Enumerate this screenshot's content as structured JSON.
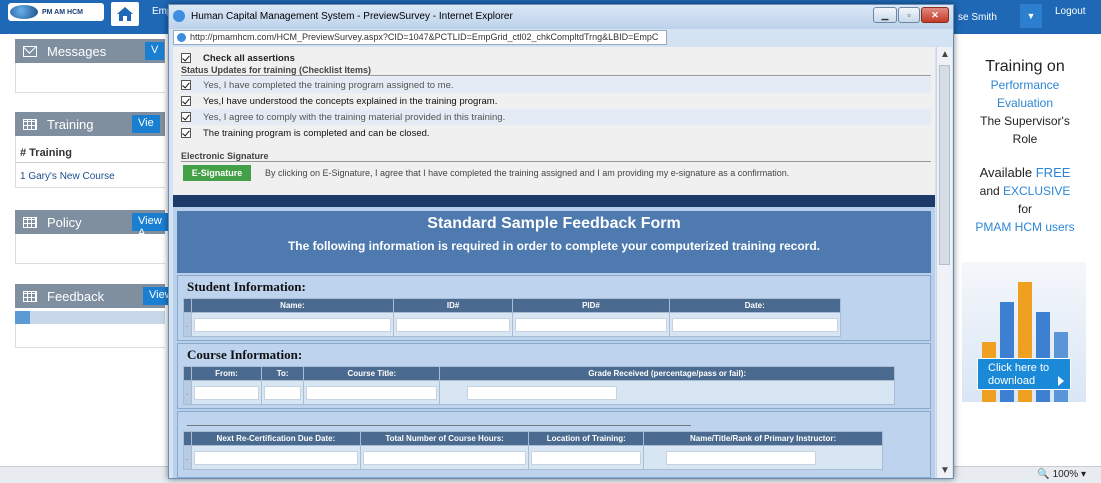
{
  "app": {
    "logo_text": "PM AM HCM",
    "nav_partial": "Emp",
    "user_partial": "se Smith",
    "logout": "Logout"
  },
  "left": {
    "messages": {
      "title": "Messages",
      "view": "V"
    },
    "training": {
      "title": "Training",
      "view": "Vie",
      "col_header": "# Training",
      "items": [
        {
          "num": "1",
          "name": "Gary's New Course"
        }
      ]
    },
    "policy": {
      "title": "Policy",
      "view": "View A"
    },
    "feedback": {
      "title": "Feedback",
      "view": "View"
    }
  },
  "promo": {
    "line1": "Training on",
    "line2": "Performance",
    "line3": "Evaluation",
    "line4": "The Supervisor's",
    "line5": "Role",
    "line6a": "Available ",
    "line6b": "FREE",
    "line7a": "and ",
    "line7b": "EXCLUSIVE",
    "line8": "for",
    "line9": "PMAM HCM users",
    "download": "Click here to download"
  },
  "statusbar": {
    "zoom": "100%"
  },
  "popup": {
    "title": "Human Capital Management System - PreviewSurvey - Internet Explorer",
    "url": "http://pmamhcm.com/HCM_PreviewSurvey.aspx?CID=1047&PCTLID=EmpGrid_ctl02_chkCompltdTrng&LBID=EmpC",
    "check_all": "Check all assertions",
    "status_label": "Status Updates for training (Checklist Items)",
    "checklist": [
      "Yes, I have completed the training program assigned to me.",
      "Yes,I have understood the concepts explained in the training program.",
      "Yes, I agree to comply with the training material provided in this training.",
      "The training program is completed and can be closed."
    ],
    "esig_label": "Electronic Signature",
    "esig_button": "E-Signature",
    "esig_text": "By clicking on E-Signature, I agree that I have completed the training assigned and I am providing my e-signature as a confirmation.",
    "form_title": "Standard Sample Feedback Form",
    "form_subtitle": "The following information is required in order to complete your computerized training record.",
    "student": {
      "title": "Student Information:",
      "cols": [
        "Name:",
        "ID#",
        "PID#",
        "Date:"
      ]
    },
    "course": {
      "title": "Course Information:",
      "cols": [
        "From:",
        "To:",
        "Course Title:",
        "Grade Received (percentage/pass or fail):"
      ]
    },
    "extra": {
      "cols": [
        "Next Re-Certification Due Date:",
        "Total Number of Course Hours:",
        "Location of Training:",
        "Name/Title/Rank of Primary Instructor:"
      ]
    },
    "lead_mark": "."
  }
}
